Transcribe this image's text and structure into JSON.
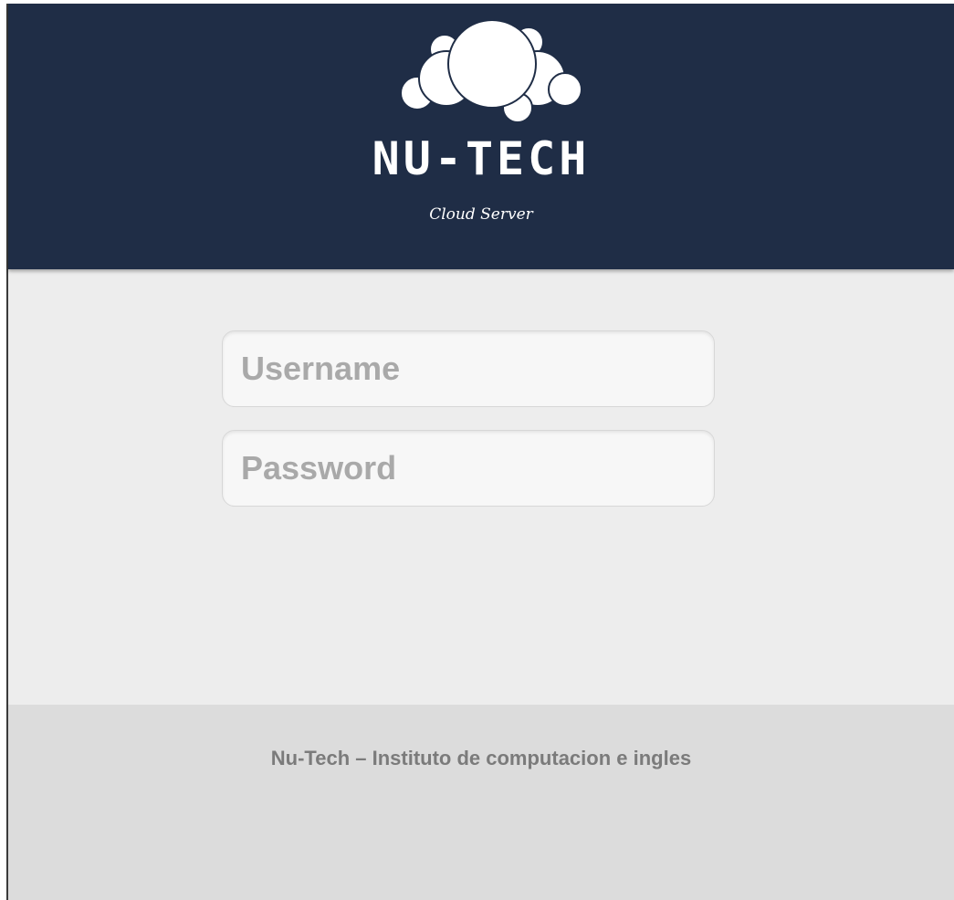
{
  "header": {
    "logo_icon": "cloud-icon",
    "brand_name": "NU-TECH",
    "tagline": "Cloud Server",
    "background_color": "#1f2d46"
  },
  "login_form": {
    "username": {
      "placeholder": "Username",
      "value": ""
    },
    "password": {
      "placeholder": "Password",
      "value": ""
    }
  },
  "footer": {
    "text": "Nu-Tech – Instituto de computacion e ingles",
    "background_color": "#dcdcdc"
  },
  "colors": {
    "page_background": "#ededed",
    "header_background": "#1f2d46",
    "footer_text": "#7b7b7b",
    "placeholder_text": "#a9a9a9"
  }
}
